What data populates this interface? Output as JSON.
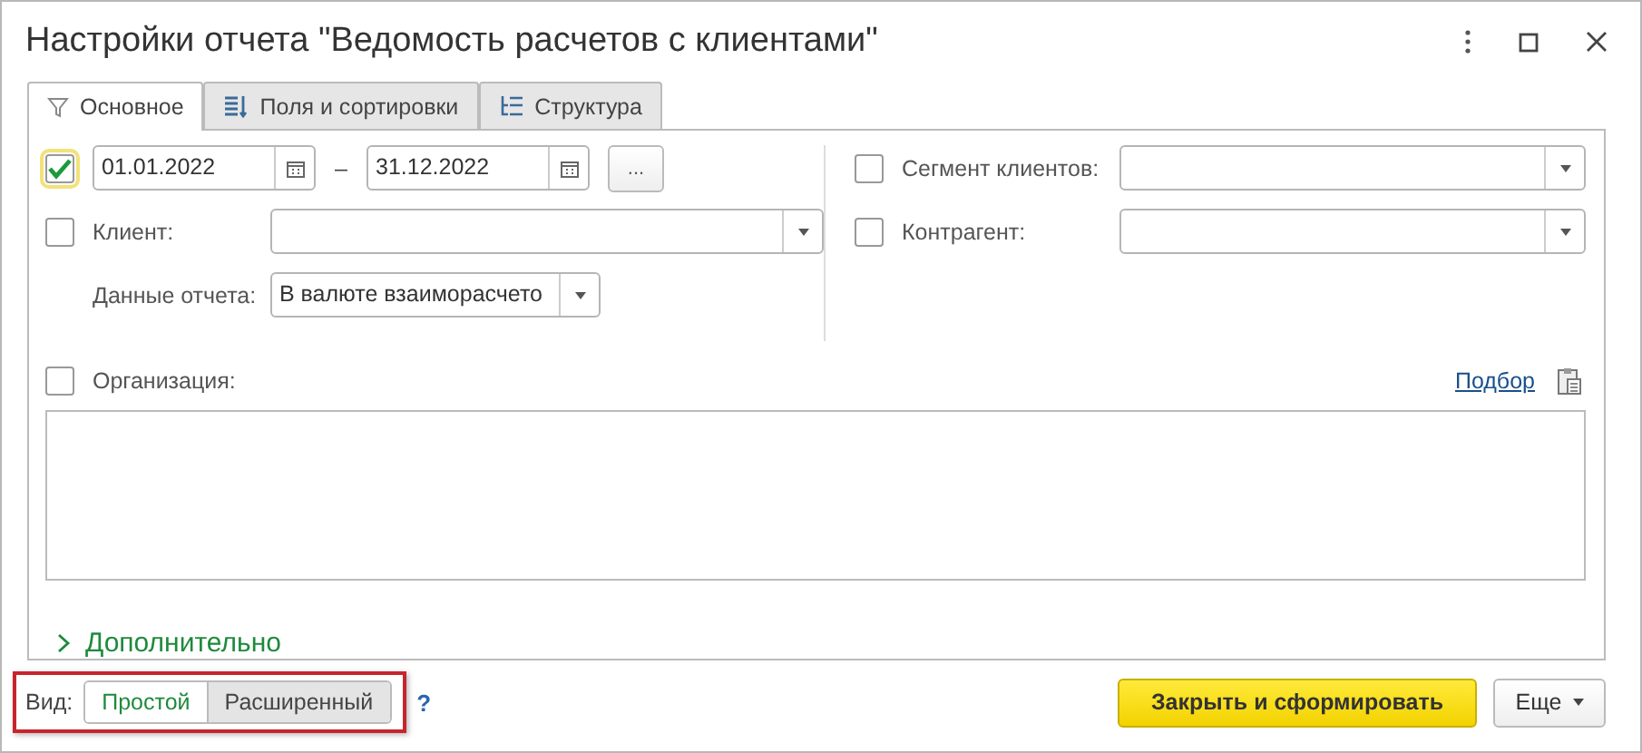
{
  "window": {
    "title": "Настройки отчета \"Ведомость расчетов с клиентами\""
  },
  "tabs": [
    {
      "label": "Основное",
      "selected": true
    },
    {
      "label": "Поля и сортировки",
      "selected": false
    },
    {
      "label": "Структура",
      "selected": false
    }
  ],
  "period": {
    "checked": true,
    "from": "01.01.2022",
    "to": "31.12.2022",
    "separator": "–",
    "button": "..."
  },
  "client": {
    "checked": false,
    "label": "Клиент:"
  },
  "report_data": {
    "label": "Данные отчета:",
    "value": "В валюте взаиморасчето"
  },
  "segment": {
    "checked": false,
    "label": "Сегмент клиентов:"
  },
  "counterparty": {
    "checked": false,
    "label": "Контрагент:"
  },
  "organization": {
    "checked": false,
    "label": "Организация:",
    "pick_link": "Подбор"
  },
  "more": {
    "label": "Дополнительно",
    "expanded": false
  },
  "footer": {
    "view_label": "Вид:",
    "views": [
      {
        "label": "Простой",
        "selected": true
      },
      {
        "label": "Расширенный",
        "selected": false
      }
    ],
    "help": "?",
    "primary": "Закрыть и сформировать",
    "more": "Еще"
  }
}
